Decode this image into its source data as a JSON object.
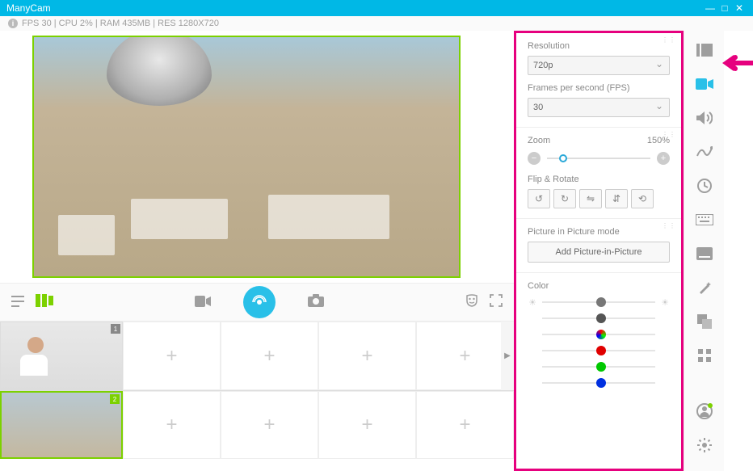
{
  "titlebar": {
    "title": "ManyCam"
  },
  "info": {
    "text": "FPS 30 | CPU 2% | RAM 435MB | RES 1280X720"
  },
  "panel": {
    "resolution": {
      "label": "Resolution",
      "value": "720p"
    },
    "fps": {
      "label": "Frames per second (FPS)",
      "value": "30"
    },
    "zoom": {
      "label": "Zoom",
      "value": "150%"
    },
    "flip": {
      "label": "Flip & Rotate"
    },
    "pip": {
      "label": "Picture in Picture mode",
      "button": "Add Picture-in-Picture"
    },
    "color": {
      "label": "Color"
    }
  },
  "presets": {
    "thumb1_num": "1",
    "thumb2_num": "2"
  }
}
